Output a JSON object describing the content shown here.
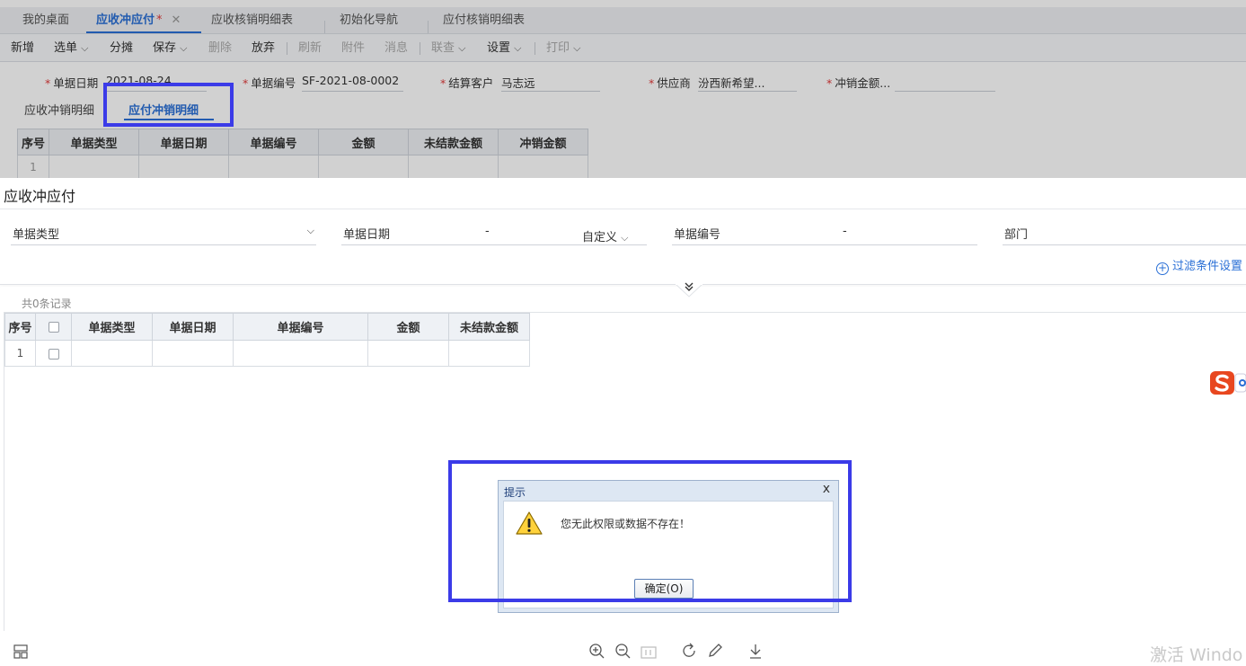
{
  "tabs": [
    {
      "label": "我的桌面",
      "active": false
    },
    {
      "label": "应收冲应付",
      "active": true,
      "modified_mark": "*",
      "close": "✕"
    },
    {
      "label": "应收核销明细表",
      "active": false
    },
    {
      "label": "初始化导航",
      "active": false
    },
    {
      "label": "应付核销明细表",
      "active": false
    }
  ],
  "toolbar": {
    "add": "新增",
    "select": "选单",
    "split": "分摊",
    "save": "保存",
    "delete": "删除",
    "abandon": "放弃",
    "refresh": "刷新",
    "attachment": "附件",
    "message": "消息",
    "query": "联查",
    "settings": "设置",
    "print": "打印"
  },
  "bg_form": {
    "date_label": "单据日期",
    "date_value": "2021-08-24",
    "number_label": "单据编号",
    "number_value": "SF-2021-08-0002",
    "customer_label": "结算客户",
    "customer_value": "马志远",
    "supplier_label": "供应商",
    "supplier_value": "汾西新希望...",
    "amount_label": "冲销金额...",
    "required_mark": "*"
  },
  "bg_subtabs": {
    "receivable": "应收冲销明细",
    "payable": "应付冲销明细"
  },
  "bg_table": {
    "headers": [
      "序号",
      "单据类型",
      "单据日期",
      "单据编号",
      "金额",
      "未结款金额",
      "冲销金额"
    ],
    "row_index": "1"
  },
  "page": {
    "title": "应收冲应付"
  },
  "filters": {
    "doc_type_label": "单据类型",
    "doc_date_label": "单据日期",
    "dash": "-",
    "custom_label": "自定义",
    "doc_number_label": "单据编号",
    "dept_label": "部门",
    "setting_link": "过滤条件设置"
  },
  "record_count": "共0条记录",
  "main_table": {
    "headers": [
      "序号",
      "单据类型",
      "单据日期",
      "单据编号",
      "金额",
      "未结款金额"
    ],
    "row_index": "1"
  },
  "dialog": {
    "title": "提示",
    "close": "x",
    "message": "您无此权限或数据不存在！",
    "ok_button": "确定(O)"
  },
  "watermark": "激活 Windo",
  "colors": {
    "accent": "#2a6fd6",
    "highlight": "#3b3be8",
    "required": "#e03a3a"
  }
}
